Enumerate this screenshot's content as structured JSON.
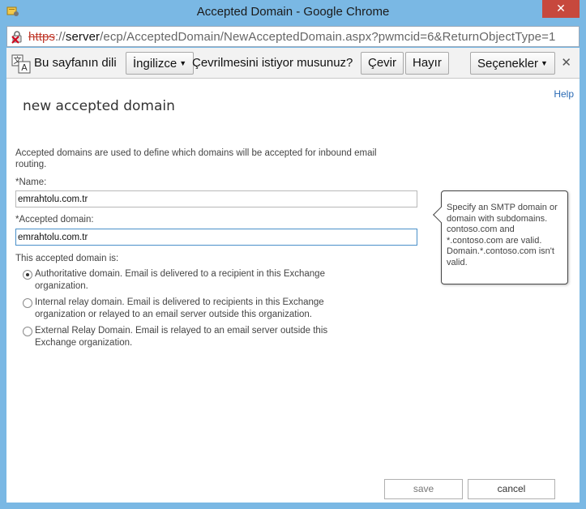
{
  "window": {
    "title": "Accepted Domain - Google Chrome",
    "close_label": "✕"
  },
  "address_bar": {
    "protocol": "https",
    "separator": "://",
    "host": "server",
    "path": "/ecp/AcceptedDomain/NewAcceptedDomain.aspx?pwmcid=6&ReturnObjectType=1"
  },
  "translate_bar": {
    "prefix": "Bu sayfanın dili",
    "language": "İngilizce",
    "question": "Çevrilmesini istiyor musunuz?",
    "translate_label": "Çevir",
    "decline_label": "Hayır",
    "options_label": "Seçenekler",
    "close_label": "✕"
  },
  "page": {
    "help": "Help",
    "title": "new accepted domain",
    "description": "Accepted domains are used to define which domains will be accepted for inbound email routing.",
    "name_label": "*Name:",
    "name_value": "emrahtolu.com.tr",
    "domain_label": "*Accepted domain:",
    "domain_value": "emrahtolu.com.tr",
    "type_label": "This accepted domain is:",
    "options": [
      {
        "label": "Authoritative domain. Email is delivered to a recipient in this Exchange organization.",
        "checked": true
      },
      {
        "label": "Internal relay domain. Email is delivered to recipients in this Exchange organization or relayed to an email server outside this organization.",
        "checked": false
      },
      {
        "label": "External Relay Domain. Email is relayed to an email server outside this Exchange organization.",
        "checked": false
      }
    ],
    "tooltip": "Specify an SMTP domain or domain with subdomains. contoso.com and *.contoso.com are valid. Domain.*.contoso.com isn't valid.",
    "save_label": "save",
    "cancel_label": "cancel"
  },
  "colors": {
    "title_bar": "#7ab8e4",
    "close_button": "#c7483d",
    "link": "#2b6bb5",
    "focus_border": "#4a90c9"
  }
}
